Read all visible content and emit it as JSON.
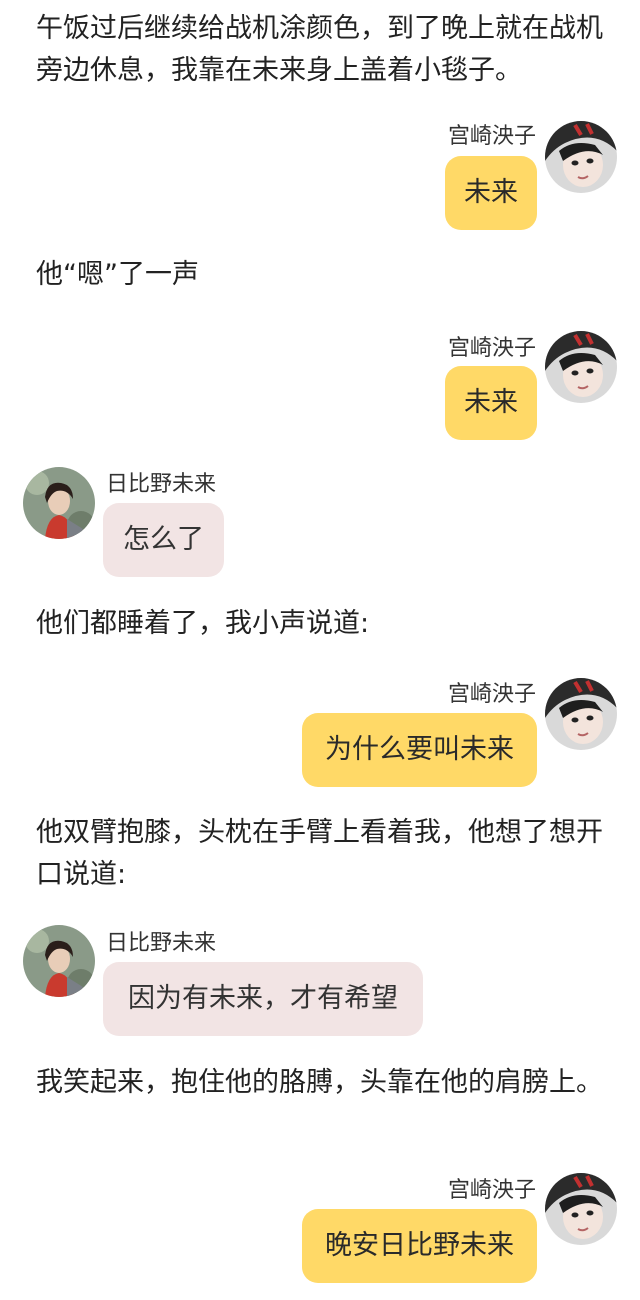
{
  "characters": {
    "kesshi": {
      "name": "宫崎泱子",
      "avatar_icon": "girl-helmet-avatar-icon",
      "bubble_color": "#ffd967"
    },
    "mirai": {
      "name": "日比野未来",
      "avatar_icon": "boy-uniform-avatar-icon",
      "bubble_color": "#f2e4e4"
    }
  },
  "narration": [
    "午饭过后继续给战机涂颜色，到了晚上就在战机旁边休息，我靠在未来身上盖着小毯子。",
    "他“嗯”了一声",
    "他们都睡着了，我小声说道:",
    "他双臂抱膝，头枕在手臂上看着我，他想了想开口说道:",
    "我笑起来，抱住他的胳膊，头靠在他的肩膀上。"
  ],
  "messages": [
    {
      "speaker": "宫崎泱子",
      "text": "未来"
    },
    {
      "speaker": "宫崎泱子",
      "text": "未来"
    },
    {
      "speaker": "日比野未来",
      "text": "怎么了"
    },
    {
      "speaker": "宫崎泱子",
      "text": "为什么要叫未来"
    },
    {
      "speaker": "日比野未来",
      "text": "因为有未来，才有希望"
    },
    {
      "speaker": "宫崎泱子",
      "text": "晚安日比野未来"
    }
  ]
}
